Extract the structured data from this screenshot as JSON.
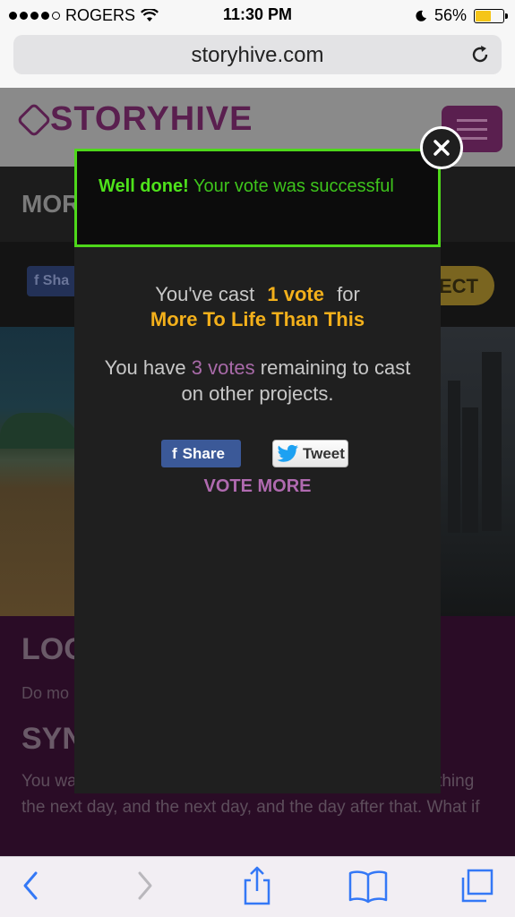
{
  "status_bar": {
    "carrier": "ROGERS",
    "time": "11:30 PM",
    "battery_percent": "56%",
    "battery_level": 0.56
  },
  "browser": {
    "url": "storyhive.com"
  },
  "site": {
    "logo": "STORYHIVE",
    "logo_sub": "",
    "title_fragment": "MOR",
    "share_fragment": "Sha",
    "select_fragment": "ECT",
    "loc_heading_fragment": "LOC",
    "tagline_fragment": "Do mo",
    "synopsis_heading_fragment": "SYN",
    "synopsis_text": "You wa                                    come home, and go to sleep. You do the same thing the next day, and the next day, and the day after that. What if"
  },
  "modal": {
    "alert_strong": "Well done!",
    "alert_text": " Your vote was successful",
    "cast_prefix": "You've cast",
    "cast_count": "1 vote",
    "cast_suffix": "for",
    "project_name": "More To Life Than This",
    "remaining_prefix": "You have ",
    "remaining_votes": "3 votes",
    "remaining_suffix": " remaining to cast on other projects.",
    "share_label": "Share",
    "tweet_label": "Tweet",
    "vote_more_label": "VOTE MORE"
  },
  "colors": {
    "success_green": "#4ed81a",
    "vote_orange": "#f3b01b",
    "accent_purple": "#b06ab0",
    "facebook_blue": "#3b5998",
    "ios_blue": "#3478f6"
  }
}
